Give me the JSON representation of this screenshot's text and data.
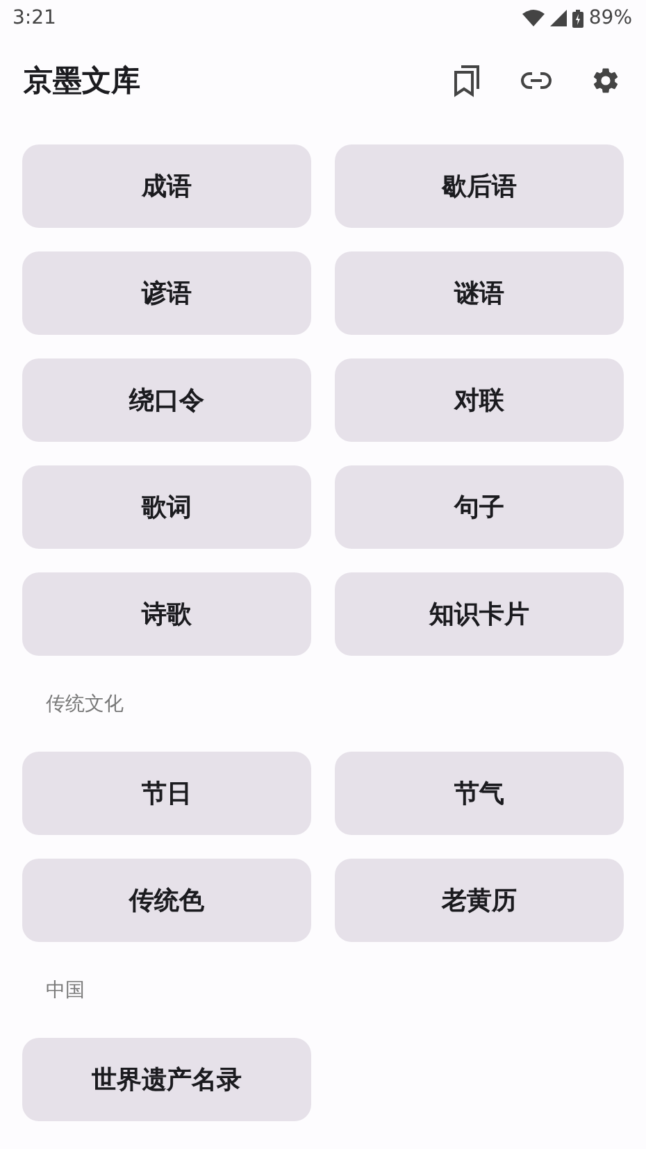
{
  "status_bar": {
    "time": "3:21",
    "battery": "89%"
  },
  "app_bar": {
    "title": "京墨文库"
  },
  "sections": [
    {
      "tiles": [
        "成语",
        "歇后语",
        "谚语",
        "谜语",
        "绕口令",
        "对联",
        "歌词",
        "句子",
        "诗歌",
        "知识卡片"
      ]
    },
    {
      "header": "传统文化",
      "tiles": [
        "节日",
        "节气",
        "传统色",
        "老黄历"
      ]
    },
    {
      "header": "中国",
      "tiles": [
        "世界遗产名录"
      ]
    }
  ]
}
